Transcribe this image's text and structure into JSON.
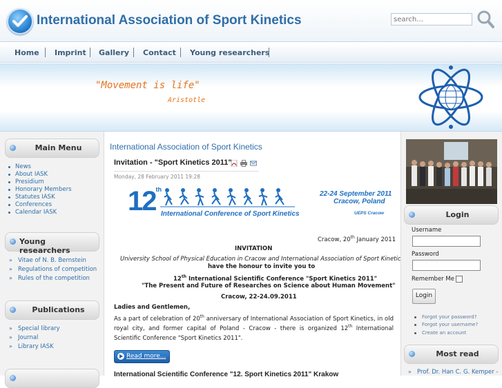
{
  "header": {
    "title": "International Association of Sport Kinetics",
    "search_placeholder": "search..."
  },
  "nav": [
    "Home",
    "Imprint",
    "Gallery",
    "Contact",
    "Young researchers"
  ],
  "banner": {
    "quote": "\"Movement is life\"",
    "author": "Aristotle"
  },
  "left": {
    "main_menu": {
      "title": "Main Menu",
      "items": [
        "News",
        "About IASK",
        "Presidium",
        "Honorary Members",
        "Statutes IASK",
        "Conferences",
        "Calendar IASK"
      ]
    },
    "young_researchers": {
      "title": "Young researchers",
      "items": [
        "Vitae of N. B. Bernstein",
        "Regulations of competition",
        "Rules of the competition"
      ]
    },
    "publications": {
      "title": "Publications",
      "items": [
        "Special library",
        "Journal",
        "Library IASK"
      ]
    }
  },
  "main": {
    "heading": "International Association of Sport Kinetics",
    "article": {
      "title": "Invitation - \"Sport Kinetics 2011\"",
      "date": "Monday, 28 February 2011 19:28",
      "banner_number": "12",
      "banner_number_suffix": "th",
      "banner_dates": "22-24 September 2011",
      "banner_place": "Cracow, Poland",
      "banner_org": "UEPS Cracow",
      "banner_name": "International Conference of Sport Kinetics",
      "place_date": "Cracow, 20",
      "place_date_sup": "th",
      "place_date_rest": " January 2011",
      "invitation": "INVITATION",
      "line1": "University School of Physical Education in Cracow and International Association of Sport Kinetics",
      "line2": "have the honour to invite you to",
      "line3_a": "12",
      "line3_sup": "th",
      "line3_b": " International Scientific Conference \"Sport Kinetics 2011\"",
      "line4": "\"The Present and Future of Researches on Science about Human Movement\"",
      "line5": "Cracow, 22-24.09.2011",
      "greeting": "Ladies and Gentlemen,",
      "body_a": "As a part of celebration of 20",
      "body_sup1": "th",
      "body_b": " anniversary of International Association of Sport Kinetics, in old royal city, and former capital of Poland - Cracow - there is organized 12",
      "body_sup2": "th",
      "body_c": " International Scientific Conference \"Sport Kinetics 2011\".",
      "read_more": "Read more..."
    },
    "next_article_title": "International Scientific Conference \"12. Sport Kinetics 2011\" Krakow"
  },
  "right": {
    "login": {
      "title": "Login",
      "username_label": "Username",
      "password_label": "Password",
      "remember_label": "Remember Me",
      "button": "Login",
      "links": [
        "Forgot your password?",
        "Forgot your username?",
        "Create an account"
      ]
    },
    "most_read": {
      "title": "Most read",
      "first_item": "Prof. Dr. Han C. G. Kemper -"
    }
  },
  "colors": {
    "link": "#2f6ea8",
    "title": "#2f6ea8",
    "quote": "#e8731c",
    "conference": "#1f6fc0"
  }
}
